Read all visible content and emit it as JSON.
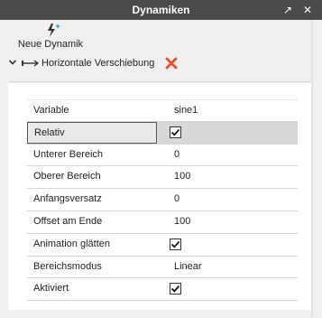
{
  "window": {
    "title": "Dynamiken",
    "pin_icon": "↗",
    "close_icon": "✕"
  },
  "toolbar": {
    "new_dynamic_label": "Neue Dynamik",
    "new_dynamic_icon": "lightning-star-icon"
  },
  "dynamic": {
    "label": "Horizontale Verschiebung",
    "expand_icon": "chevron-down-icon",
    "type_icon": "horizontal-arrow-icon",
    "delete_icon": "red-x-icon",
    "delete_color": "#e8502a"
  },
  "properties": [
    {
      "key": "Variable",
      "value": "sine1",
      "kind": "text"
    },
    {
      "key": "Relativ",
      "value": "",
      "checked": true,
      "kind": "checkbox",
      "selected": true
    },
    {
      "key": "Unterer Bereich",
      "value": "0",
      "kind": "text"
    },
    {
      "key": "Oberer Bereich",
      "value": "100",
      "kind": "text"
    },
    {
      "key": "Anfangsversatz",
      "value": "0",
      "kind": "text"
    },
    {
      "key": "Offset am Ende",
      "value": "100",
      "kind": "text"
    },
    {
      "key": "Animation glätten",
      "value": "",
      "checked": true,
      "kind": "checkbox"
    },
    {
      "key": "Bereichsmodus",
      "value": "Linear",
      "kind": "text"
    },
    {
      "key": "Aktiviert",
      "value": "",
      "checked": true,
      "kind": "checkbox"
    }
  ],
  "colors": {
    "titlebar": "#4a4a4a",
    "accent_lightning": "#1a9fd8",
    "selected_row": "#d8d8d8"
  }
}
